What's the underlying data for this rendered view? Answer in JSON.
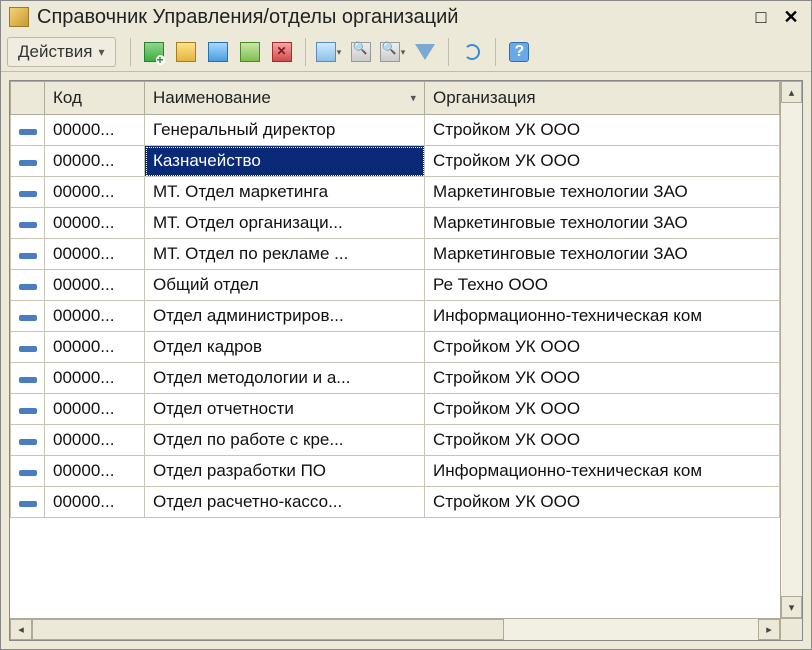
{
  "window": {
    "title": "Справочник Управления/отделы организаций"
  },
  "toolbar": {
    "actions_label": "Действия"
  },
  "grid": {
    "columns": {
      "code": "Код",
      "name": "Наименование",
      "org": "Организация"
    },
    "selected_index": 1,
    "rows": [
      {
        "code": "00000...",
        "name": "Генеральный директор",
        "org": "Стройком УК ООО"
      },
      {
        "code": "00000...",
        "name": "Казначейство",
        "org": "Стройком УК ООО"
      },
      {
        "code": "00000...",
        "name": "МТ. Отдел маркетинга",
        "org": "Маркетинговые технологии ЗАО"
      },
      {
        "code": "00000...",
        "name": "МТ. Отдел организаци...",
        "org": "Маркетинговые технологии ЗАО"
      },
      {
        "code": "00000...",
        "name": "МТ. Отдел по рекламе ...",
        "org": "Маркетинговые технологии ЗАО"
      },
      {
        "code": "00000...",
        "name": "Общий отдел",
        "org": "Ре Техно ООО"
      },
      {
        "code": "00000...",
        "name": "Отдел администриров...",
        "org": "Информационно-техническая ком"
      },
      {
        "code": "00000...",
        "name": "Отдел кадров",
        "org": "Стройком УК ООО"
      },
      {
        "code": "00000...",
        "name": "Отдел методологии и а...",
        "org": "Стройком УК ООО"
      },
      {
        "code": "00000...",
        "name": "Отдел отчетности",
        "org": "Стройком УК ООО"
      },
      {
        "code": "00000...",
        "name": "Отдел по работе с кре...",
        "org": "Стройком УК ООО"
      },
      {
        "code": "00000...",
        "name": "Отдел разработки ПО",
        "org": "Информационно-техническая ком"
      },
      {
        "code": "00000...",
        "name": "Отдел расчетно-кассо...",
        "org": "Стройком УК ООО"
      }
    ]
  }
}
